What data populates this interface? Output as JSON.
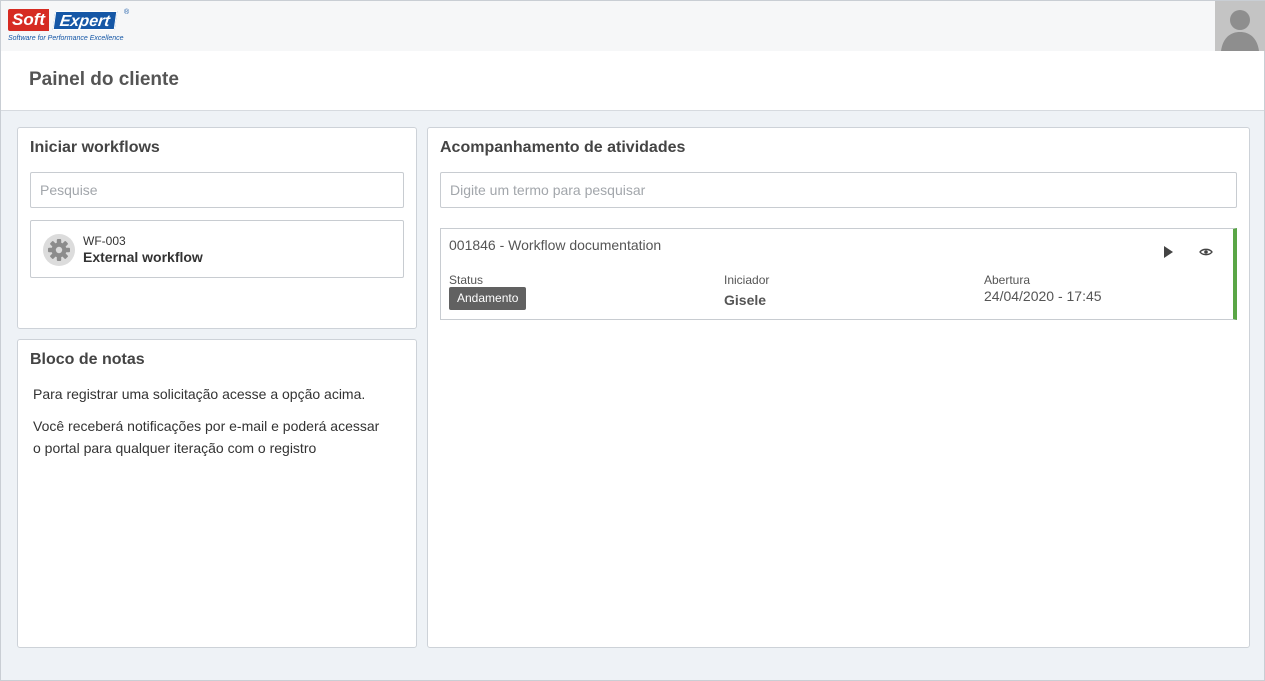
{
  "brand": {
    "soft": "Soft",
    "expert": "Expert",
    "registered": "®",
    "tagline": "Software for Performance Excellence"
  },
  "header": {
    "title": "Painel do cliente"
  },
  "workflows": {
    "title": "Iniciar workflows",
    "search_placeholder": "Pesquise",
    "items": [
      {
        "code": "WF-003",
        "name": "External workflow",
        "icon": "gear-icon"
      }
    ]
  },
  "notes": {
    "title": "Bloco de notas",
    "lines": [
      "Para registrar uma solicitação acesse a opção acima.",
      "Você receberá notificações por e-mail e poderá acessar",
      "o portal para qualquer iteração com o registro"
    ]
  },
  "tracking": {
    "title": "Acompanhamento de atividades",
    "search_placeholder": "Digite um termo para pesquisar",
    "activities": [
      {
        "title": "001846 - Workflow documentation",
        "status_label": "Status",
        "status": "Andamento",
        "initiator_label": "Iniciador",
        "initiator": "Gisele",
        "opening_label": "Abertura",
        "opening": "24/04/2020 - 17:45"
      }
    ]
  },
  "colors": {
    "brand_red": "#d62b22",
    "brand_blue": "#1557a6",
    "status_bar": "#5aa646",
    "badge": "#616161"
  }
}
